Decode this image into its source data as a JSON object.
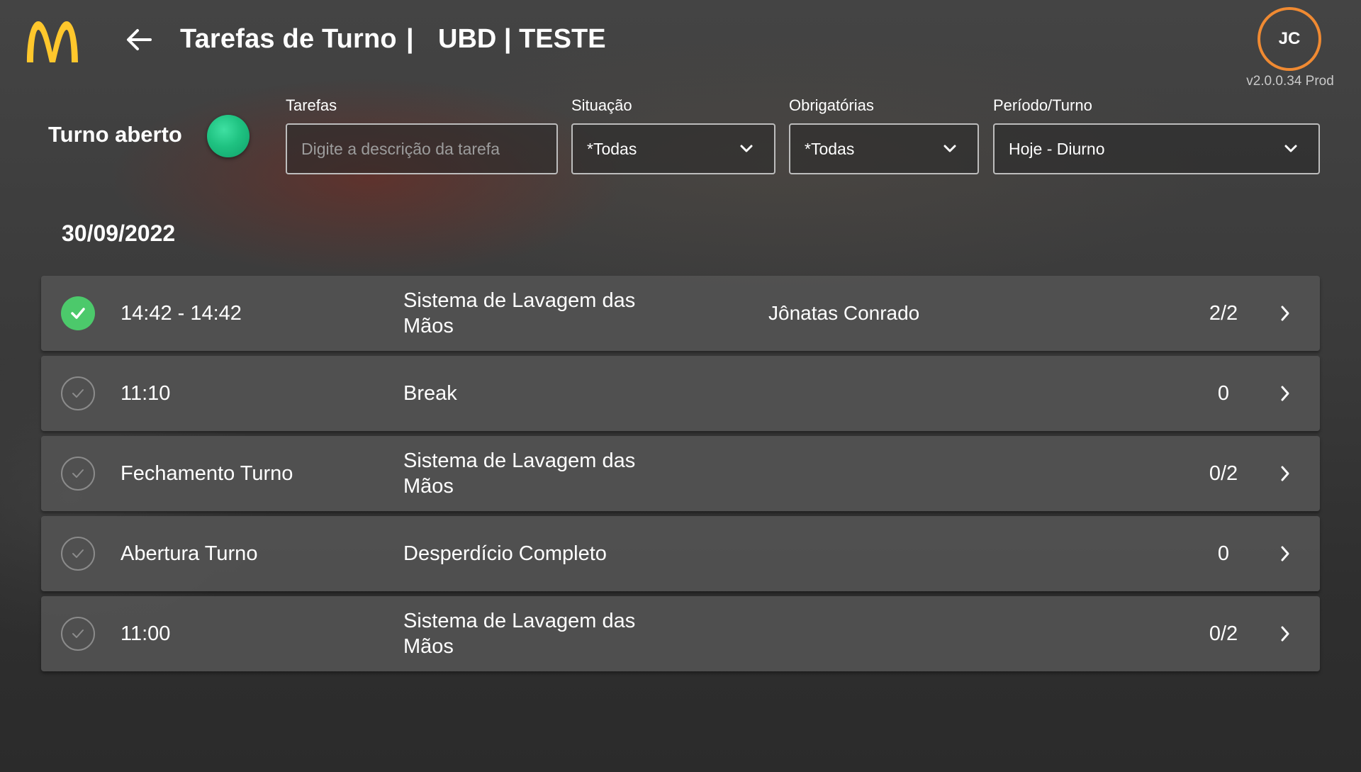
{
  "header": {
    "title": "Tarefas de Turno",
    "separator": "|",
    "store": "UBD | TESTE",
    "avatar_initials": "JC",
    "version": "v2.0.0.34 Prod",
    "logo_icon": "mcdonalds-arches-logo",
    "back_icon": "arrow-left-icon"
  },
  "shift": {
    "label": "Turno aberto",
    "status_color": "#1fc281"
  },
  "filters": {
    "tasks": {
      "label": "Tarefas",
      "placeholder": "Digite a descrição da tarefa",
      "value": ""
    },
    "status": {
      "label": "Situação",
      "value": "*Todas"
    },
    "mandatory": {
      "label": "Obrigatórias",
      "value": "*Todas"
    },
    "period": {
      "label": "Período/Turno",
      "value": "Hoje - Diurno"
    }
  },
  "date": "30/09/2022",
  "tasks": [
    {
      "time": "14:42 - 14:42",
      "name": "Sistema de Lavagem das Mãos",
      "user": "Jônatas Conrado",
      "count": "2/2",
      "done": true
    },
    {
      "time": "11:10",
      "name": "Break",
      "user": "",
      "count": "0",
      "done": false
    },
    {
      "time": "Fechamento Turno",
      "name": "Sistema de Lavagem das Mãos",
      "user": "",
      "count": "0/2",
      "done": false
    },
    {
      "time": "Abertura Turno",
      "name": "Desperdício Completo",
      "user": "",
      "count": "0",
      "done": false
    },
    {
      "time": "11:00",
      "name": "Sistema de Lavagem das Mãos",
      "user": "",
      "count": "0/2",
      "done": false
    }
  ],
  "colors": {
    "accent_orange": "#f08a32",
    "done_green": "#4cc96b",
    "logo_yellow": "#ffc72c"
  }
}
